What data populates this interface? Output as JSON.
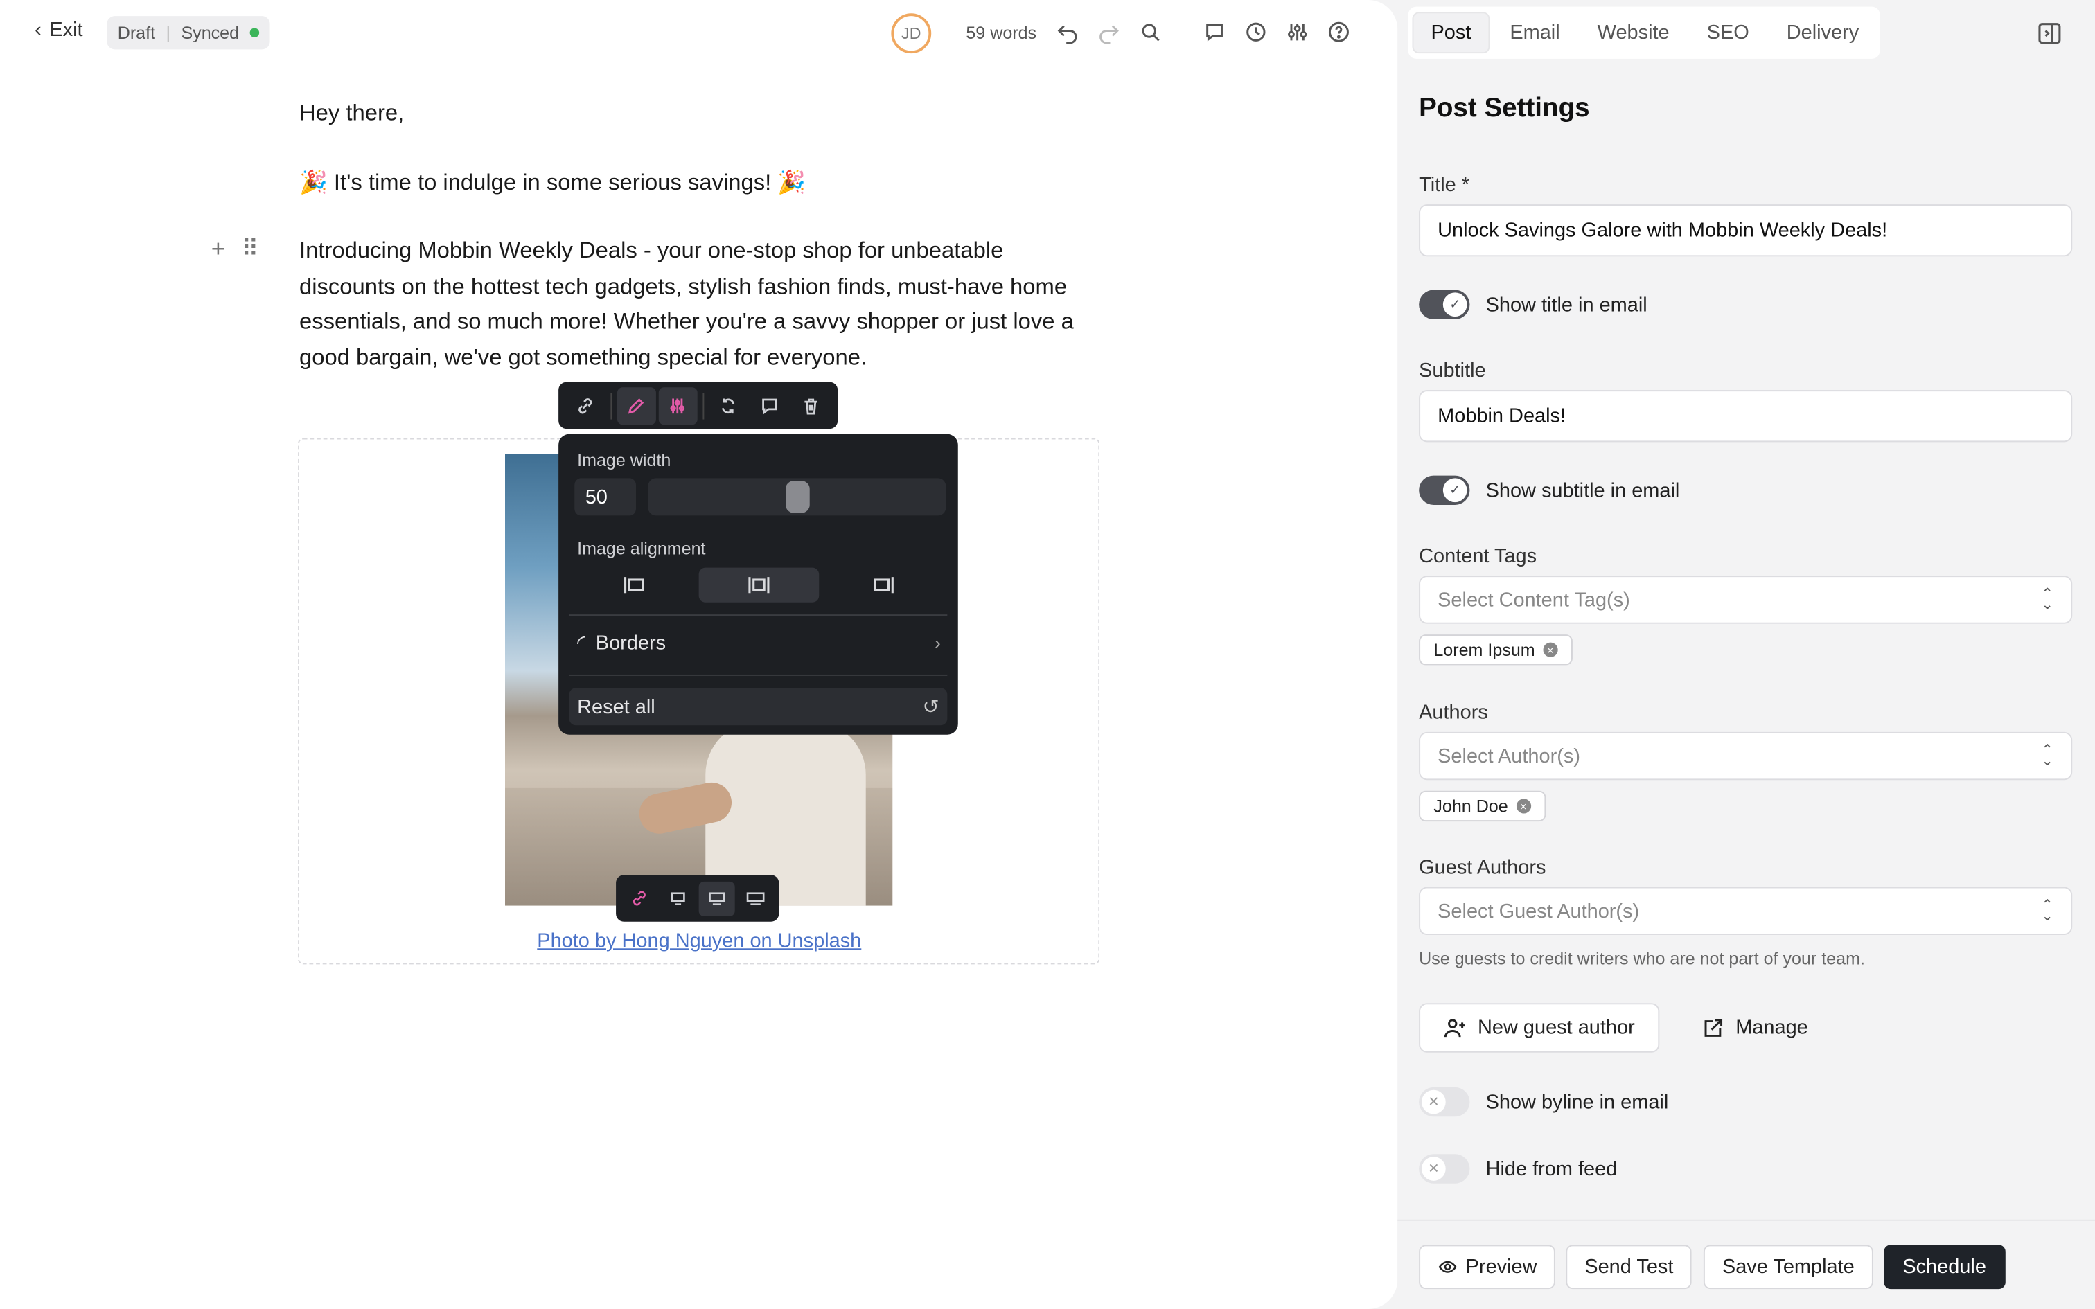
{
  "topbar": {
    "exit_label": "Exit",
    "status": "Draft",
    "sync": "Synced",
    "avatar_initials": "JD",
    "word_count": "59 words"
  },
  "document": {
    "greeting": "Hey there,",
    "headline": "🎉 It's time to indulge in some serious savings! 🎉",
    "body": "Introducing Mobbin Weekly Deals - your one-stop shop for unbeatable discounts on the hottest tech gadgets, stylish fashion finds, must-have home essentials, and so much more! Whether you're a savvy shopper or just love a good bargain, we've got something special for everyone.",
    "caption": "Photo by Hong Nguyen on Unsplash"
  },
  "image_settings": {
    "width_label": "Image width",
    "width_value": "50",
    "width_percent": 50,
    "alignment_label": "Image alignment",
    "alignment_selected": "center",
    "borders_label": "Borders",
    "reset_label": "Reset all"
  },
  "settings": {
    "tabs": [
      {
        "label": "Post",
        "active": true
      },
      {
        "label": "Email",
        "active": false
      },
      {
        "label": "Website",
        "active": false
      },
      {
        "label": "SEO",
        "active": false
      },
      {
        "label": "Delivery",
        "active": false
      }
    ],
    "heading": "Post Settings",
    "title_label": "Title *",
    "title_value": "Unlock Savings Galore with Mobbin Weekly Deals!",
    "show_title_label": "Show title in email",
    "show_title_on": true,
    "subtitle_label": "Subtitle",
    "subtitle_value": "Mobbin Deals!",
    "show_subtitle_label": "Show subtitle in email",
    "show_subtitle_on": true,
    "content_tags_label": "Content Tags",
    "content_tags_placeholder": "Select Content Tag(s)",
    "content_tags": [
      "Lorem Ipsum"
    ],
    "authors_label": "Authors",
    "authors_placeholder": "Select Author(s)",
    "authors": [
      "John Doe"
    ],
    "guest_authors_label": "Guest Authors",
    "guest_authors_placeholder": "Select Guest Author(s)",
    "guest_hint": "Use guests to credit writers who are not part of your team.",
    "new_guest_label": "New guest author",
    "manage_label": "Manage",
    "show_byline_label": "Show byline in email",
    "show_byline_on": false,
    "hide_feed_label": "Hide from feed",
    "hide_feed_on": false
  },
  "footer": {
    "preview": "Preview",
    "send_test": "Send Test",
    "save_template": "Save Template",
    "schedule": "Schedule"
  },
  "colors": {
    "accent_pink": "#e25ba8",
    "synced_green": "#3cb55a",
    "primary_dark": "#1f2329"
  }
}
